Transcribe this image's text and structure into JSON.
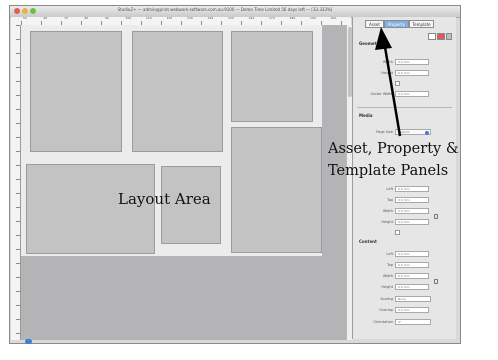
{
  "window": {
    "title": "StudioZ+ — admin@print.webwork-software.com.au:9100 — Demo Time Limited 56 days left — [33.333%]"
  },
  "ruler": {
    "top_ticks": [
      "50",
      "60",
      "70",
      "80",
      "90",
      "100",
      "110",
      "120",
      "130",
      "140",
      "150",
      "160",
      "170",
      "180",
      "190",
      "200"
    ]
  },
  "panel": {
    "tabs": [
      "Asset",
      "Property",
      "Template"
    ],
    "active_tab": "Property",
    "sections": {
      "geometry": "Geometry",
      "media": "Media",
      "content": "Content"
    },
    "geometry_rows": [
      {
        "label": "Width",
        "value": "0.0 mm"
      },
      {
        "label": "Height",
        "value": "0.0 mm"
      },
      {
        "label": "Gutter Width",
        "value": "0.0 mm"
      }
    ],
    "media_rows": [
      {
        "label": "Page Size",
        "value": "Custom"
      },
      {
        "label": "Left",
        "value": "0.0 mm"
      },
      {
        "label": "Top",
        "value": "0.0 mm"
      },
      {
        "label": "Width",
        "value": "0.0 mm"
      },
      {
        "label": "Height",
        "value": "0.0 mm"
      }
    ],
    "content_rows": [
      {
        "label": "Left",
        "value": "0.0 mm"
      },
      {
        "label": "Top",
        "value": "0.0 mm"
      },
      {
        "label": "Width",
        "value": "0.0 mm"
      },
      {
        "label": "Height",
        "value": "0.0 mm"
      },
      {
        "label": "Scaling",
        "value": "None"
      },
      {
        "label": "Overlap",
        "value": "0.0 mm"
      },
      {
        "label": "Orientation",
        "value": "0°"
      }
    ]
  },
  "annotations": {
    "layout_area": "Layout Area",
    "panels_line1": "Asset, Property &",
    "panels_line2": "Template Panels"
  },
  "colors": {
    "accent": "#3f7ed6",
    "active_tab": "#7fb0ea",
    "canvas_bg": "#b4b4b7",
    "frame_fill": "#c3c3c3"
  }
}
